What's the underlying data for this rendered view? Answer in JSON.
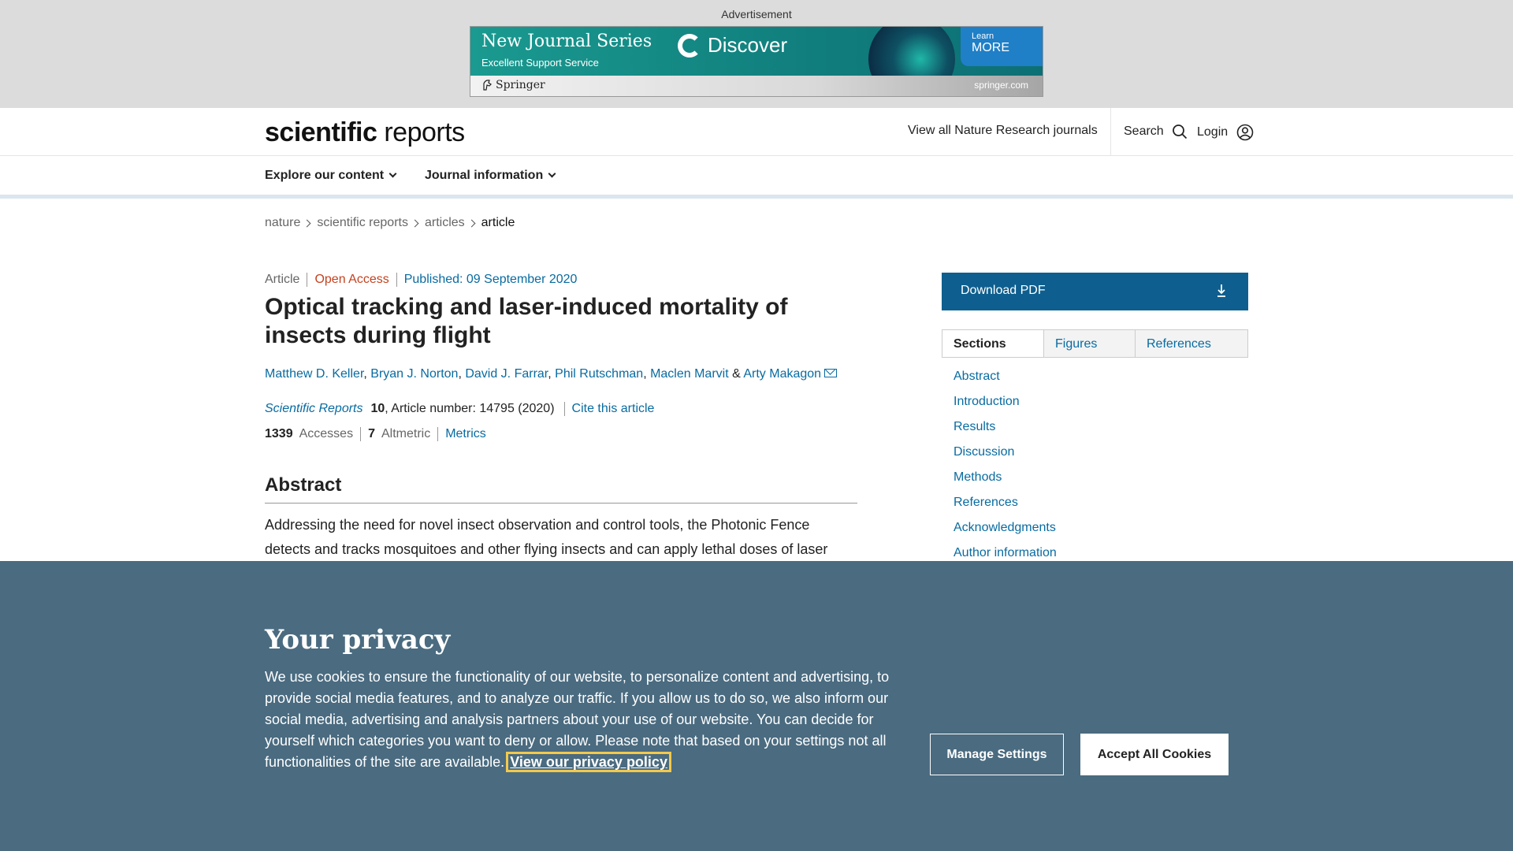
{
  "ad": {
    "label": "Advertisement",
    "title": "New Journal Series",
    "subtitle": "Excellent Support Service",
    "brand": "Discover",
    "cta_line1": "Learn",
    "cta_line2": "MORE",
    "publisher": "Springer",
    "domain": "springer.com"
  },
  "header": {
    "logo_bold": "scientific",
    "logo_light": "reports",
    "all_journals": "View all Nature Research journals",
    "search": "Search",
    "login": "Login"
  },
  "nav": {
    "explore": "Explore our content",
    "journal_info": "Journal information"
  },
  "breadcrumb": [
    "nature",
    "scientific reports",
    "articles",
    "article"
  ],
  "article": {
    "type": "Article",
    "access": "Open Access",
    "published": "Published: 09 September 2020",
    "title": "Optical tracking and laser-induced mortality of insects during flight",
    "authors": [
      "Matthew D. Keller",
      "Bryan J. Norton",
      "David J. Farrar",
      "Phil Rutschman",
      "Maclen Marvit",
      "Arty Makagon"
    ],
    "journal": "Scientific Reports",
    "volume": "10",
    "article_number": ", Article number: 14795 (2020)",
    "cite": "Cite this article",
    "accesses_count": "1339",
    "accesses_label": "Accesses",
    "altmetric_count": "7",
    "altmetric_label": "Altmetric",
    "metrics": "Metrics",
    "abstract_heading": "Abstract",
    "abstract_text": "Addressing the need for novel insect observation and control tools, the Photonic Fence detects and tracks mosquitoes and other flying insects and can apply lethal doses of laser"
  },
  "sidebar": {
    "download": "Download PDF",
    "tabs": [
      "Sections",
      "Figures",
      "References"
    ],
    "sections": [
      "Abstract",
      "Introduction",
      "Results",
      "Discussion",
      "Methods",
      "References",
      "Acknowledgments",
      "Author information"
    ]
  },
  "cookie": {
    "heading": "Your privacy",
    "text": "We use cookies to ensure the functionality of our website, to personalize content and advertising, to provide social media features, and to analyze our traffic. If you allow us to do so, we also inform our social media, advertising and analysis partners about your use of our website. You can decide for yourself which categories you want to deny or allow. Please note that based on your settings not all functionalities of the site are available.",
    "policy_link": "View our privacy policy",
    "manage": "Manage Settings",
    "accept": "Accept All Cookies"
  },
  "colors": {
    "link": "#086ba1",
    "open_access": "#c4421f",
    "download_button": "#0e5f8f",
    "cookie_bg": "#4a6b80"
  }
}
